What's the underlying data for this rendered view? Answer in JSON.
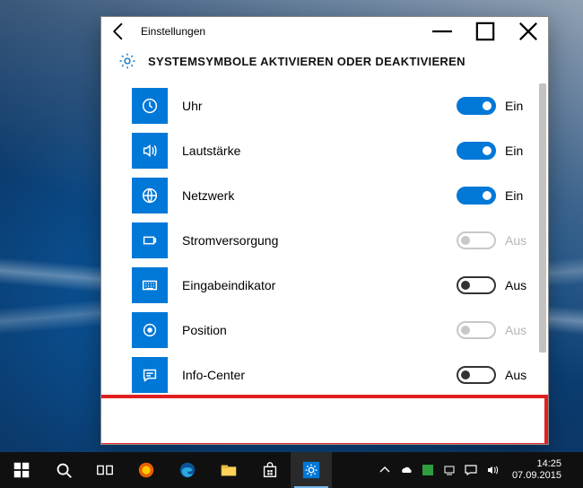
{
  "window": {
    "title": "Einstellungen",
    "heading": "SYSTEMSYMBOLE AKTIVIEREN ODER DEAKTIVIEREN"
  },
  "items": [
    {
      "label": "Uhr",
      "state": "Ein",
      "on": true,
      "enabled": true
    },
    {
      "label": "Lautstärke",
      "state": "Ein",
      "on": true,
      "enabled": true
    },
    {
      "label": "Netzwerk",
      "state": "Ein",
      "on": true,
      "enabled": true
    },
    {
      "label": "Stromversorgung",
      "state": "Aus",
      "on": false,
      "enabled": false
    },
    {
      "label": "Eingabeindikator",
      "state": "Aus",
      "on": false,
      "enabled": true
    },
    {
      "label": "Position",
      "state": "Aus",
      "on": false,
      "enabled": false
    },
    {
      "label": "Info-Center",
      "state": "Aus",
      "on": false,
      "enabled": true
    }
  ],
  "taskbar": {
    "time": "14:25",
    "date": "07.09.2015"
  }
}
